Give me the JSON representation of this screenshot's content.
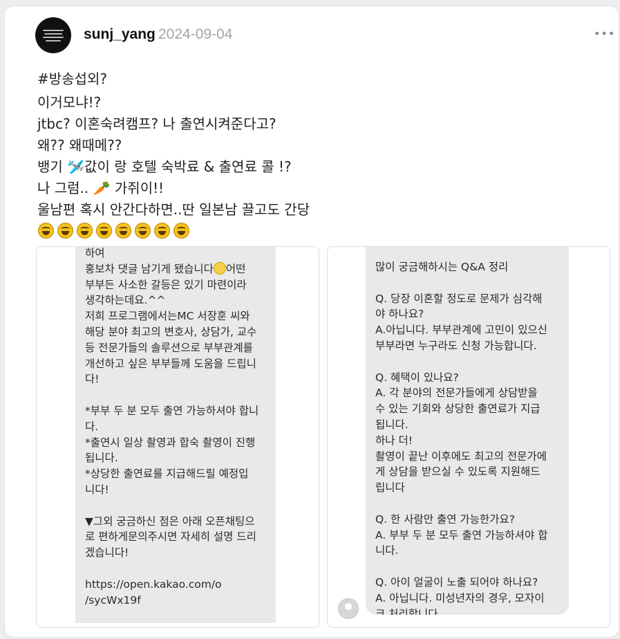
{
  "post": {
    "username": "sunj_yang",
    "date": "2024-09-04",
    "more_label": "•••",
    "hashtag": "#방송섭외?",
    "lines": [
      "이거모냐!?",
      "jtbc? 이혼숙려캠프? 나 출연시켜준다고?",
      "왜?? 왜때메??",
      "뱅기 🛩️값이 랑 호텔 숙박료 & 출연료 콜 !?",
      "나 그럼.. 🥕 가쥐이!!",
      "울남편 혹시 안간다하면..딴 일본남 끌고도 간당"
    ],
    "emoji_count": 8
  },
  "left_image": {
    "line_1": "하여",
    "line_2a": "홍보차 댓글 남기게 됐습니다",
    "line_2b": "어떤",
    "rest": "부부든 사소한 갈등은 있기 마련이라\n생각하는데요.^^\n저희 프로그램에서는MC 서장훈 씨와\n해당 분야 최고의 변호사, 상담가, 교수\n등 전문가들의 솔루션으로 부부관계를\n개선하고 싶은 부부들께 도움을 드립니\n다!\n\n*부부 두 분 모두 출연 가능하셔야 합니\n다.\n*출연시 일상 촬영과 합숙 촬영이 진행\n됩니다.\n*상당한 출연료를 지급해드릴 예정입\n니다!\n\n▼그외 궁금하신 점은 아래 오픈채팅으\n로 편하게문의주시면 자세히 설명 드리\n겠습니다!\n\nhttps://open.kakao.com/o\n/sycWx19f"
  },
  "right_image": {
    "text": "많이 궁금해하시는 Q&A 정리\n\nQ. 당장 이혼할 정도로 문제가 심각해\n야 하나요?\nA.아닙니다. 부부관계에 고민이 있으신\n부부라면 누구라도 신청 가능합니다.\n\nQ. 혜택이 있나요?\nA. 각 분야의 전문가들에게 상담받을\n수 있는 기회와 상당한 출연료가 지급\n됩니다.\n하나 더!\n촬영이 끝난 이후에도 최고의 전문가에\n게 상담을 받으실 수 있도록 지원해드\n립니다\n\nQ. 한 사람만 출연 가능한가요?\nA. 부부 두 분 모두 출연 가능하셔야 합\n니다.\n\nQ. 아이 얼굴이 노출 되어야 하나요?\nA. 아닙니다. 미성년자의 경우, 모자이\n크 처리합니다."
  },
  "colors": {
    "card_bg": "#ffffff",
    "page_bg": "#ededed",
    "date_gray": "#a5a5a5",
    "screenshot_bg": "#e9e9e9"
  }
}
